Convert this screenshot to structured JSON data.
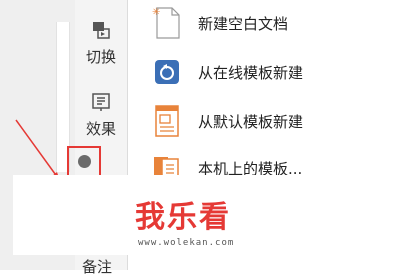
{
  "ribbon": {
    "switch_label": "切换",
    "effect_label": "效果",
    "notes_label": "备注"
  },
  "menu": {
    "items": [
      {
        "label": "新建空白文档",
        "icon": "blank-document-icon"
      },
      {
        "label": "从在线模板新建",
        "icon": "online-template-icon"
      },
      {
        "label": "从默认模板新建",
        "icon": "default-template-icon"
      },
      {
        "label": "本机上的模板...",
        "icon": "local-template-icon"
      }
    ]
  },
  "watermark": {
    "brand": "我乐看",
    "url": "www.wolekan.com"
  },
  "colors": {
    "highlight": "#e53935",
    "ribbon_bg": "#f4f4f4",
    "accent_blue": "#3b6fb6",
    "accent_orange": "#e8833a"
  }
}
